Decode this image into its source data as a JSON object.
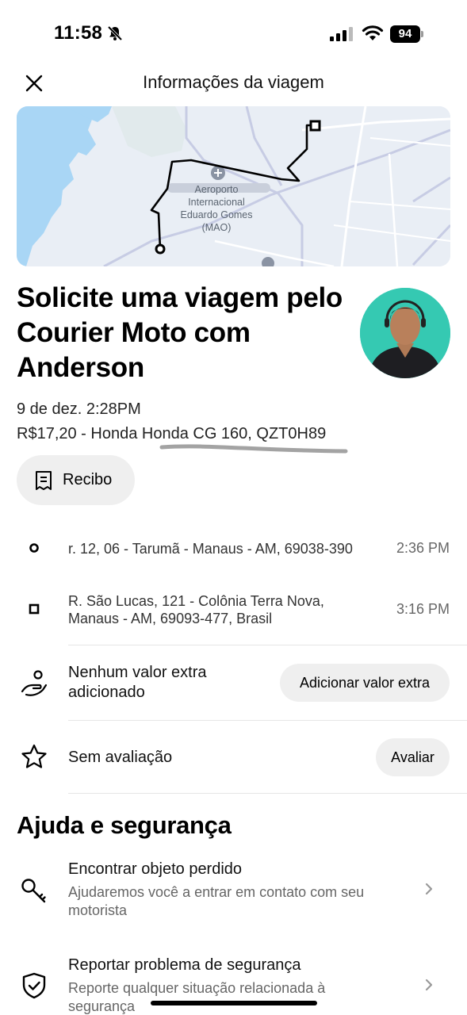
{
  "status": {
    "time": "11:58",
    "battery": "94"
  },
  "header": {
    "title": "Informações da viagem"
  },
  "map": {
    "airport_label": "Aeroporto Internacional Eduardo Gomes (MAO)"
  },
  "trip": {
    "title": "Solicite uma viagem pelo Courier Moto com Anderson",
    "date": "9 de dez. 2:28PM",
    "price_vehicle": "R$17,20 - Honda Honda CG 160, QZT0H89",
    "receipt_label": "Recibo"
  },
  "stops": [
    {
      "address": "r. 12, 06 - Tarumã - Manaus - AM, 69038-390",
      "time": "2:36 PM"
    },
    {
      "address": "R. São Lucas, 121 - Colônia Terra Nova, Manaus - AM, 69093-477, Brasil",
      "time": "3:16 PM"
    }
  ],
  "tip": {
    "text": "Nenhum valor extra adicionado",
    "button": "Adicionar valor extra"
  },
  "rating": {
    "text": "Sem avaliação",
    "button": "Avaliar"
  },
  "help": {
    "title": "Ajuda e segurança",
    "items": [
      {
        "title": "Encontrar objeto perdido",
        "subtitle": "Ajudaremos você a entrar em contato com seu motorista"
      },
      {
        "title": "Reportar problema de segurança",
        "subtitle": "Reporte qualquer situação relacionada à segurança"
      }
    ]
  },
  "icons": {
    "close": "close-icon",
    "receipt": "receipt-icon",
    "pickup": "pickup-circle-icon",
    "dropoff": "dropoff-square-icon",
    "tip": "hand-coin-icon",
    "rating": "star-icon",
    "lost_item": "key-icon",
    "safety": "shield-check-icon",
    "chevron": "chevron-right-icon"
  }
}
